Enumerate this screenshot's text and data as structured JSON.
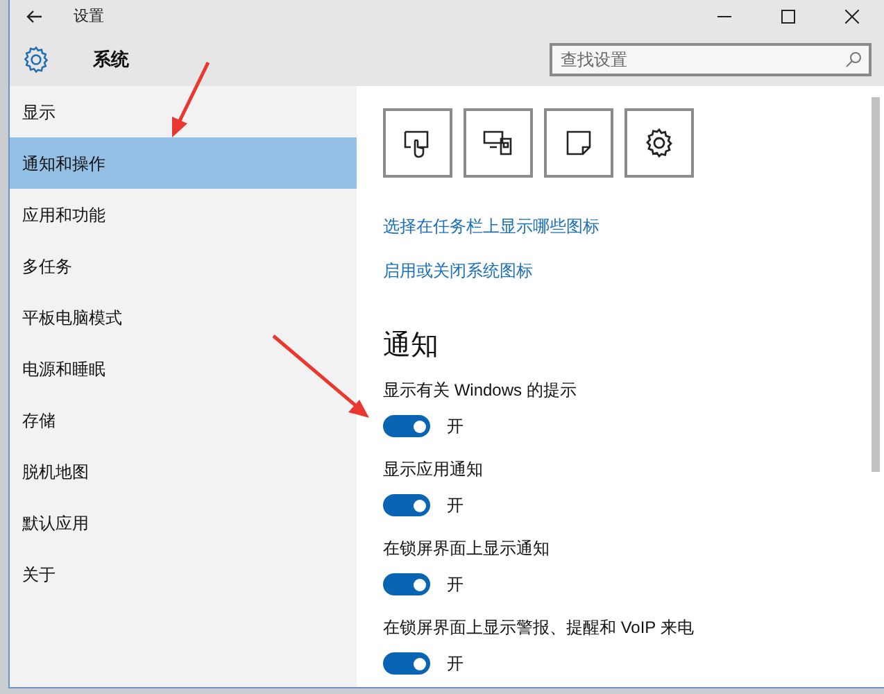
{
  "window": {
    "title": "设置"
  },
  "header": {
    "title": "系统",
    "search": {
      "placeholder": "查找设置"
    }
  },
  "sidebar": {
    "items": [
      {
        "label": "显示",
        "selected": false
      },
      {
        "label": "通知和操作",
        "selected": true
      },
      {
        "label": "应用和功能",
        "selected": false
      },
      {
        "label": "多任务",
        "selected": false
      },
      {
        "label": "平板电脑模式",
        "selected": false
      },
      {
        "label": "电源和睡眠",
        "selected": false
      },
      {
        "label": "存储",
        "selected": false
      },
      {
        "label": "脱机地图",
        "selected": false
      },
      {
        "label": "默认应用",
        "selected": false
      },
      {
        "label": "关于",
        "selected": false
      }
    ]
  },
  "quick_actions": [
    {
      "kind": "touch"
    },
    {
      "kind": "project"
    },
    {
      "kind": "note"
    },
    {
      "kind": "settings"
    }
  ],
  "links": [
    "选择在任务栏上显示哪些图标",
    "启用或关闭系统图标"
  ],
  "notifications": {
    "heading": "通知",
    "toggles": [
      {
        "label": "显示有关 Windows 的提示",
        "on": true,
        "state_text": "开"
      },
      {
        "label": "显示应用通知",
        "on": true,
        "state_text": "开"
      },
      {
        "label": "在锁屏界面上显示通知",
        "on": true,
        "state_text": "开"
      },
      {
        "label": "在锁屏界面上显示警报、提醒和 VoIP 来电",
        "on": true,
        "state_text": "开"
      }
    ]
  }
}
